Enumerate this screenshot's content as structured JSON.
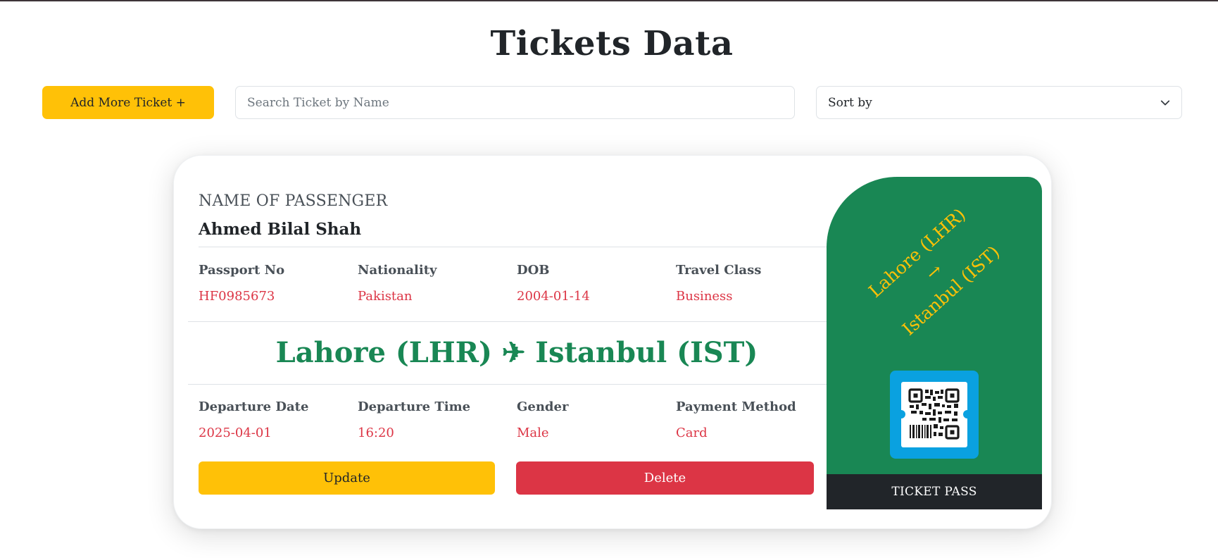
{
  "page": {
    "title": "Tickets Data"
  },
  "toolbar": {
    "add_label": "Add More Ticket +",
    "search_placeholder": "Search Ticket by Name",
    "search_value": "",
    "sort_value": "Sort by"
  },
  "ticket": {
    "name_label": "NAME OF PASSENGER",
    "name": "Ahmed Bilal Shah",
    "details": [
      {
        "label": "Passport No",
        "value": "HF0985673"
      },
      {
        "label": "Nationality",
        "value": "Pakistan"
      },
      {
        "label": "DOB",
        "value": "2004-01-14"
      },
      {
        "label": "Travel Class",
        "value": "Business"
      }
    ],
    "route": "Lahore (LHR) ✈ Istanbul (IST)",
    "flight": [
      {
        "label": "Departure Date",
        "value": "2025-04-01"
      },
      {
        "label": "Departure Time",
        "value": "16:20"
      },
      {
        "label": "Gender",
        "value": "Male"
      },
      {
        "label": "Payment Method",
        "value": "Card"
      }
    ],
    "update_label": "Update",
    "delete_label": "Delete",
    "pass": {
      "from": "Lahore (LHR)",
      "arrow": "→",
      "to": "Istanbul (IST)",
      "footer": "TICKET PASS"
    }
  },
  "colors": {
    "accent_yellow": "#ffc107",
    "danger_red": "#dc3545",
    "success_green": "#198754",
    "dark": "#212529"
  },
  "icons": [
    "chevron-down-icon",
    "qr-code-icon"
  ]
}
